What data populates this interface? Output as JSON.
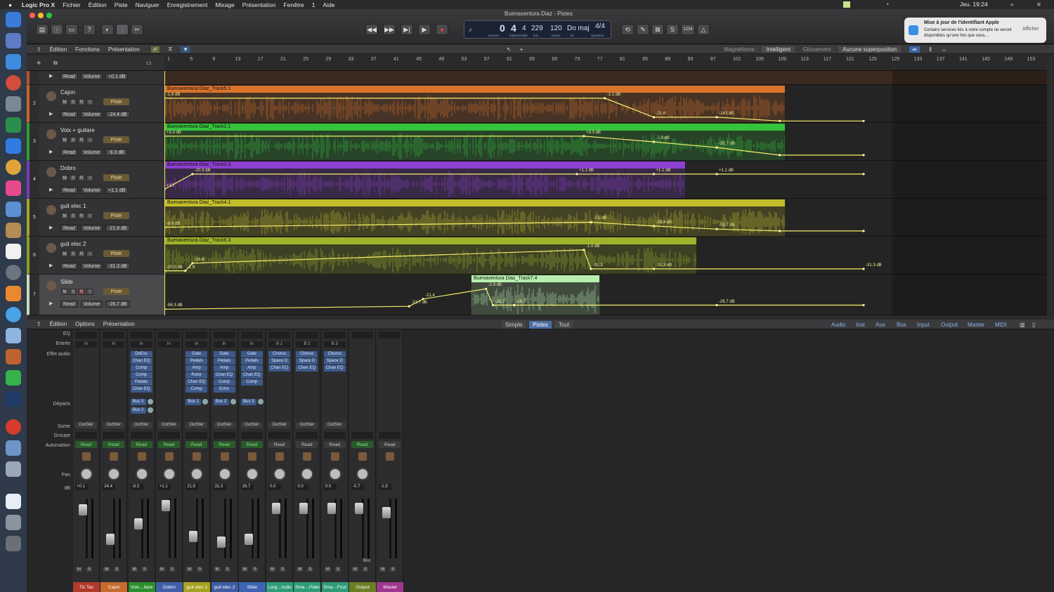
{
  "menubar": {
    "app": "Logic Pro X",
    "items": [
      "Fichier",
      "Édition",
      "Piste",
      "Naviguer",
      "Enregistrement",
      "Mixage",
      "Présentation",
      "Fenêtre",
      "1",
      "Aide"
    ],
    "clock": "Jeu. 19:24"
  },
  "window": {
    "title": "Buenaventura Diaz - Pistes"
  },
  "lcd": {
    "bar": "0",
    "beat": "4",
    "div": "4",
    "tick": "229",
    "bar_label": "mesure",
    "beat_label": "battement",
    "div_label": "div",
    "tick_label": "tick",
    "tempo": "120",
    "tempo_label": "tempo",
    "key": "Do maj",
    "key_label": "clé",
    "sig": "4/4",
    "sig_label": "signature",
    "counter": "1234"
  },
  "notification": {
    "title": "Mise à jour de l'identifiant Apple",
    "body": "Certains services liés à votre compte ne seront disponibles qu'une fois que vous…",
    "action": "Afficher"
  },
  "tracks_toolbar": {
    "edit": "Édition",
    "functions": "Fonctions",
    "view": "Présentation",
    "snap_label": "Magnétisme :",
    "snap_value": "Intelligent",
    "drag_label": "Glissement :",
    "drag_value": "Aucune superposition"
  },
  "ruler": [
    "1",
    "5",
    "9",
    "13",
    "17",
    "21",
    "25",
    "29",
    "33",
    "37",
    "41",
    "45",
    "49",
    "53",
    "57",
    "61",
    "65",
    "69",
    "73",
    "77",
    "81",
    "85",
    "89",
    "93",
    "97",
    "101",
    "105",
    "109",
    "113",
    "117",
    "121",
    "125",
    "129",
    "133",
    "137",
    "141",
    "145",
    "149",
    "153"
  ],
  "tracks": [
    {
      "num": "",
      "name": "",
      "mode": "Read",
      "param": "Volume",
      "db": "+0.1 dB",
      "color": "#b3542a"
    },
    {
      "num": "2",
      "name": "Cajon",
      "mode": "Read",
      "param": "Volume",
      "db": "-24.4 dB",
      "color": "#c9652a",
      "region": "Buenaventura Diaz_Track5.1",
      "rcolor": "#d8732c",
      "labels": [
        "-1.6 dB",
        "-1.1 dB",
        "-21.6",
        "-143 dB"
      ]
    },
    {
      "num": "3",
      "name": "Voix + guitare",
      "mode": "Read",
      "param": "Volume",
      "db": "-9.3 dB",
      "color": "#2d9f32",
      "region": "Buenaventura Diaz_Track2.1",
      "rcolor": "#36c33c",
      "labels": [
        "+3.3 dB",
        "+3.3 dB",
        "-7.9 dB",
        "-35.7 dB"
      ]
    },
    {
      "num": "4",
      "name": "Dobro",
      "mode": "Read",
      "param": "Volume",
      "db": "+1.1 dB",
      "color": "#7a3ab8",
      "region": "Buenaventura Diaz_Track3.3",
      "rcolor": "#8d3fd0",
      "labels": [
        "+1.7",
        "-20.3 dB",
        "+1.1 dB",
        "+1.1 dB",
        "+1.1 dB"
      ]
    },
    {
      "num": "5",
      "name": "guit elec 1",
      "mode": "Read",
      "param": "Volume",
      "db": "-21.9 dB",
      "color": "#a5a222",
      "region": "Buenaventura Diaz_Track4.1",
      "rcolor": "#c2bf2b",
      "labels": [
        "-8.6 dB",
        "-7.5 dB",
        "-20.4 dB",
        "-59.7 dB"
      ]
    },
    {
      "num": "6",
      "name": "guit elec 2",
      "mode": "Read",
      "param": "Volume",
      "db": "-31.3 dB",
      "color": "#8d9c24",
      "region": "Buenaventura Diaz_Track6.3",
      "rcolor": "#9fb32a",
      "labels": [
        "-20.0 dB",
        "-1.9",
        "-16.4",
        "-1.0 dB",
        "-31.3",
        "-31.3 dB",
        "-31.3 dB"
      ]
    },
    {
      "num": "7",
      "name": "Slide",
      "mode": "Read",
      "param": "Volume",
      "db": "-26.7 dB",
      "color": "#c8d9b8",
      "region": "Buenaventura Diaz_Track7.4",
      "rcolor": "#b7efb0",
      "labels": [
        "-56.3 dB",
        "-21.7 dB",
        "-21.4",
        "-2.8 dB",
        "-26.7",
        "-26.7",
        "-26.7 dB"
      ]
    }
  ],
  "mixer_toolbar": {
    "edit": "Édition",
    "options": "Options",
    "view": "Présentation",
    "tabs": [
      "Simple",
      "Pistes",
      "Tout"
    ],
    "filters": [
      "Audio",
      "Inst",
      "Aux",
      "Bus",
      "Input",
      "Output",
      "Master",
      "MIDI"
    ]
  },
  "mixer_labels": {
    "eq": "EQ",
    "input": "Entrée",
    "effects": "Effet audio",
    "sends": "Départs",
    "output": "Sortie",
    "group": "Groupe",
    "automation": "Automation",
    "pan": "Pan",
    "db": "dB"
  },
  "strips": [
    {
      "name": "Tic Tac",
      "color": "#b13a2a",
      "plugins": [],
      "sends": [],
      "out": "OutStér",
      "auto": "Read",
      "db": "+0.1",
      "input": "In"
    },
    {
      "name": "Cajon",
      "color": "#c66a2e",
      "plugins": [],
      "sends": [],
      "out": "OutStér",
      "auto": "Read",
      "db": "24.4",
      "input": "In"
    },
    {
      "name": "Voix…itare",
      "color": "#2c8f2e",
      "plugins": [
        "DeEss",
        "Chan EQ",
        "Comp",
        "Comp",
        "Pedals",
        "Chan EQ"
      ],
      "sends": [
        "Bus 3",
        "Bus 2"
      ],
      "out": "OutStér",
      "auto": "Read",
      "db": "-9.3",
      "input": "In"
    },
    {
      "name": "Dobro",
      "color": "#3f5fa8",
      "plugins": [],
      "sends": [],
      "out": "OutStér",
      "auto": "Read",
      "db": "+1.1",
      "input": "In"
    },
    {
      "name": "guit elec 1",
      "color": "#a7a322",
      "plugins": [
        "Gate",
        "Pedals",
        "Amp",
        "Rotor",
        "Chan EQ",
        "Comp"
      ],
      "sends": [
        "Bus 1"
      ],
      "out": "OutStér",
      "auto": "Read",
      "db": "21.9",
      "input": "In"
    },
    {
      "name": "guit elec 2",
      "color": "#3e5ea3",
      "plugins": [
        "Gate",
        "Pedals",
        "Amp",
        "Chan EQ",
        "Comp",
        "Echo"
      ],
      "sends": [
        "Bus 2"
      ],
      "out": "OutStér",
      "auto": "Read",
      "db": "31.3",
      "input": "In"
    },
    {
      "name": "Slide",
      "color": "#3d64b3",
      "plugins": [
        "Gate",
        "Pedals",
        "Amp",
        "Chan EQ",
        "Comp"
      ],
      "sends": [
        "Bus 3"
      ],
      "out": "OutStér",
      "auto": "Read",
      "db": "26.7",
      "input": "In"
    },
    {
      "name": "Larg…tudio",
      "color": "#2f9c78",
      "plugins": [
        "Chorus",
        "Space D",
        "Chan EQ"
      ],
      "sends": [],
      "out": "OutStér",
      "auto": "Read",
      "db": "0.0",
      "input": "B 1"
    },
    {
      "name": "Sma…Plate",
      "color": "#2f9c78",
      "plugins": [
        "Chorus",
        "Space D",
        "Chan EQ"
      ],
      "sends": [],
      "out": "OutStér",
      "auto": "Read",
      "db": "0.0",
      "input": "B 2"
    },
    {
      "name": "Sma…Four",
      "color": "#2f9c78",
      "plugins": [
        "Chorus",
        "Space D",
        "Chan EQ"
      ],
      "sends": [],
      "out": "OutStér",
      "auto": "Read",
      "db": "0.0",
      "input": "B 3"
    },
    {
      "name": "Output",
      "color": "#6a7f22",
      "plugins": [],
      "sends": [],
      "out": "",
      "auto": "Read",
      "db": "-0.7",
      "input": "",
      "extra": "Bnc"
    },
    {
      "name": "Master",
      "color": "#a0378e",
      "plugins": [],
      "sends": [],
      "out": "",
      "auto": "Read",
      "db": "-1.9",
      "input": ""
    }
  ]
}
